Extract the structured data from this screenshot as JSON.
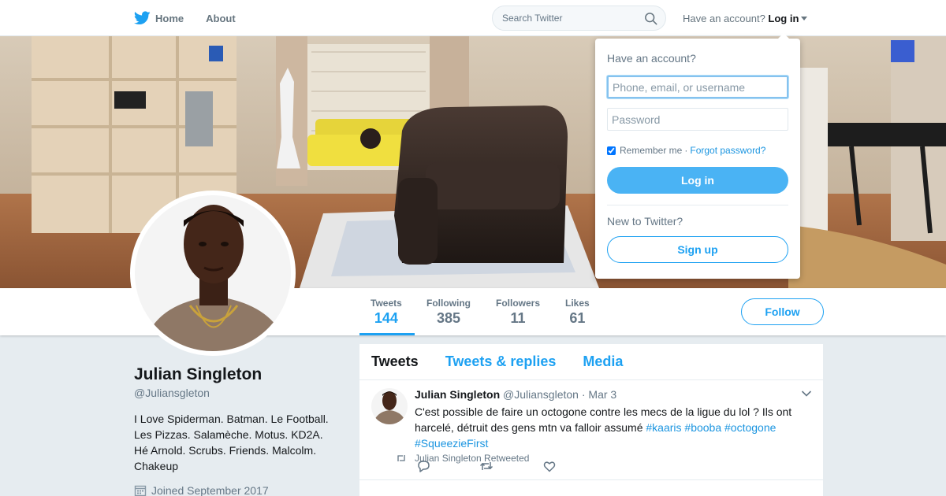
{
  "nav": {
    "home_label": "Home",
    "about_label": "About",
    "search_placeholder": "Search Twitter",
    "have_account_label": "Have an account?",
    "login_label": "Log in"
  },
  "login_dropdown": {
    "title": "Have an account?",
    "username_placeholder": "Phone, email, or username",
    "password_placeholder": "Password",
    "remember_label": "Remember me",
    "separator": "·",
    "forgot_label": "Forgot password?",
    "login_button": "Log in",
    "new_label": "New to Twitter?",
    "signup_button": "Sign up"
  },
  "stats": [
    {
      "label": "Tweets",
      "value": "144"
    },
    {
      "label": "Following",
      "value": "385"
    },
    {
      "label": "Followers",
      "value": "11"
    },
    {
      "label": "Likes",
      "value": "61"
    }
  ],
  "follow_button": "Follow",
  "profile": {
    "name": "Julian Singleton",
    "handle": "@Juliansgleton",
    "bio": "I Love Spiderman. Batman. Le Football. Les Pizzas. Salamèche. Motus. KD2A. Hé Arnold. Scrubs. Friends. Malcolm. Chakeup",
    "joined": "Joined September 2017"
  },
  "timeline": {
    "tabs": [
      "Tweets",
      "Tweets & replies",
      "Media"
    ],
    "tweet": {
      "name": "Julian Singleton",
      "handle": "@Juliansgleton",
      "dot": "·",
      "date": "Mar 3",
      "text": "C'est possible de faire un octogone contre les mecs de la ligue du lol ? Ils ont harcelé, détruit des gens mtn va falloir assumé",
      "hashtags": [
        "#kaaris",
        "#booba",
        "#octogone",
        "#SqueezieFirst"
      ]
    },
    "retweeted_label": "Julian Singleton Retweeted"
  },
  "colors": {
    "accent": "#1da1f2",
    "login_button": "#4ab3f4",
    "link": "#1b95e0"
  },
  "icons": [
    "twitter-bird-icon",
    "search-icon",
    "chevron-down-icon",
    "calendar-icon",
    "reply-icon",
    "retweet-icon",
    "heart-icon"
  ]
}
